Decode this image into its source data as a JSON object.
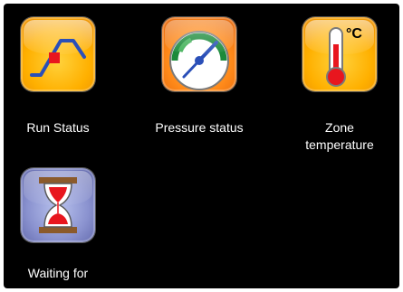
{
  "tiles": [
    {
      "name": "run-status",
      "label": "Run Status",
      "icon": "run-status-chart-icon"
    },
    {
      "name": "pressure-status",
      "label": "Pressure status",
      "icon": "pressure-gauge-icon"
    },
    {
      "name": "zone-temperature",
      "label_line1": "Zone",
      "label_line2": "temperature",
      "icon": "thermometer-celsius-icon",
      "unit": "°C"
    },
    {
      "name": "waiting-for",
      "label": "Waiting for",
      "icon": "hourglass-icon"
    }
  ],
  "colors": {
    "screen_background": "#000000",
    "tile_orange": "#ffb000",
    "tile_purple": "#8a92cf",
    "label_text": "#ffffff"
  }
}
